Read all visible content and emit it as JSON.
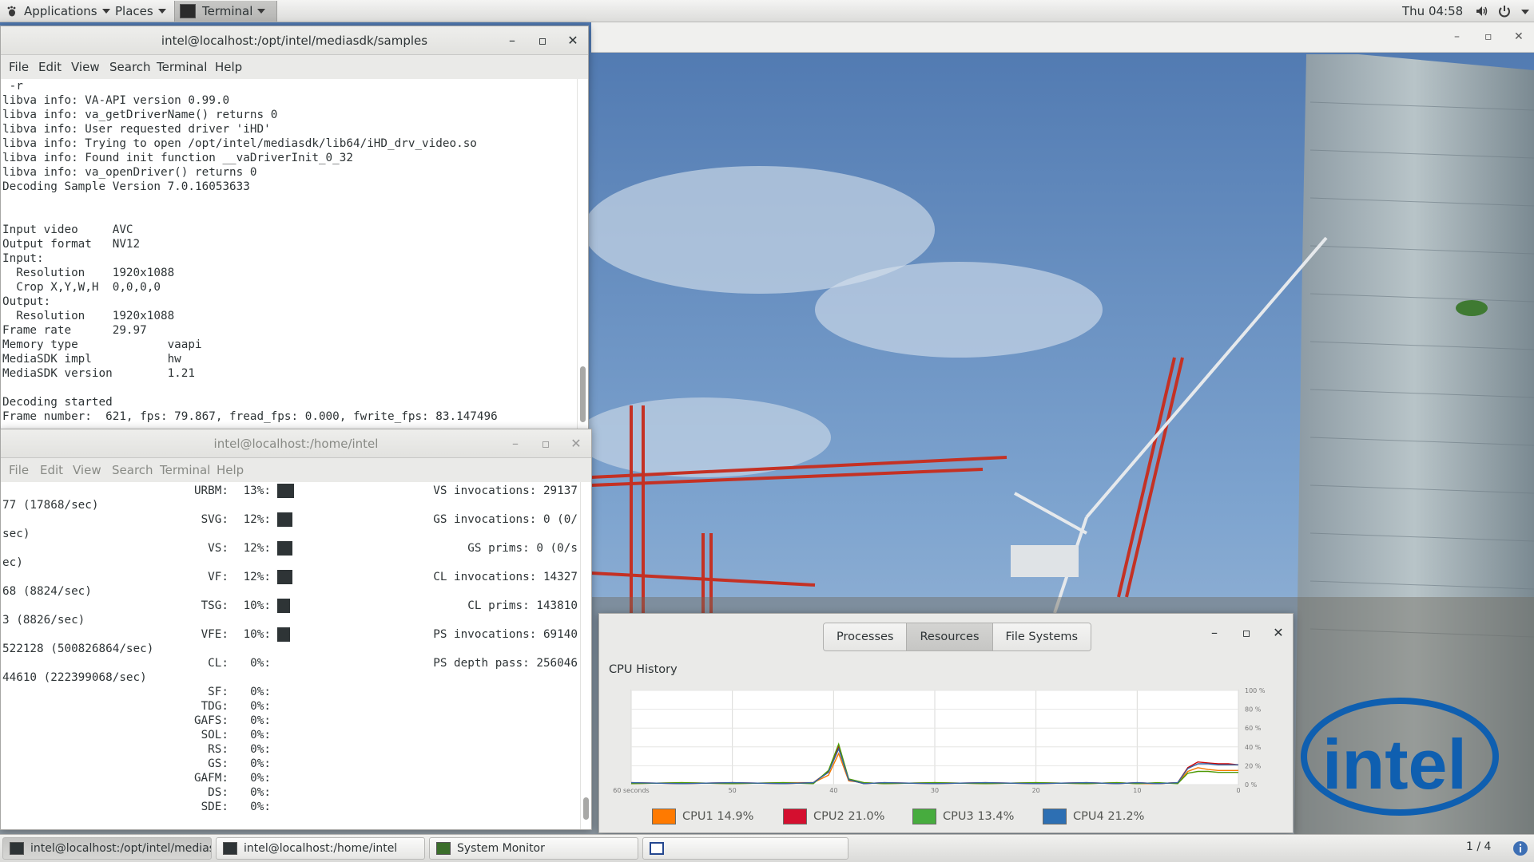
{
  "panel": {
    "applications": "Applications",
    "places": "Places",
    "terminal": "Terminal",
    "clock": "Thu 04:58"
  },
  "term1": {
    "title": "intel@localhost:/opt/intel/mediasdk/samples",
    "menu": [
      "File",
      "Edit",
      "View",
      "Search",
      "Terminal",
      "Help"
    ],
    "lines": [
      " -r",
      "libva info: VA-API version 0.99.0",
      "libva info: va_getDriverName() returns 0",
      "libva info: User requested driver 'iHD'",
      "libva info: Trying to open /opt/intel/mediasdk/lib64/iHD_drv_video.so",
      "libva info: Found init function __vaDriverInit_0_32",
      "libva info: va_openDriver() returns 0",
      "Decoding Sample Version 7.0.16053633",
      "",
      "",
      "Input video     AVC",
      "Output format   NV12",
      "Input:",
      "  Resolution    1920x1088",
      "  Crop X,Y,W,H  0,0,0,0",
      "Output:",
      "  Resolution    1920x1088",
      "Frame rate      29.97",
      "Memory type             vaapi",
      "MediaSDK impl           hw",
      "MediaSDK version        1.21",
      "",
      "Decoding started",
      "Frame number:  621, fps: 79.867, fread_fps: 0.000, fwrite_fps: 83.147496"
    ]
  },
  "term2": {
    "title": "intel@localhost:/home/intel",
    "menu": [
      "File",
      "Edit",
      "View",
      "Search",
      "Terminal",
      "Help"
    ],
    "rows": [
      {
        "left": "",
        "name": "URBM:",
        "pct": "13%:",
        "bar": 13,
        "right": "VS invocations: 29137"
      },
      {
        "left": "77 (17868/sec)",
        "name": "",
        "pct": "",
        "bar": 0,
        "right": ""
      },
      {
        "left": "",
        "name": "SVG:",
        "pct": "12%:",
        "bar": 12,
        "right": "GS invocations: 0 (0/"
      },
      {
        "left": "sec)",
        "name": "",
        "pct": "",
        "bar": 0,
        "right": ""
      },
      {
        "left": "",
        "name": "VS:",
        "pct": "12%:",
        "bar": 12,
        "right": "GS prims: 0 (0/s"
      },
      {
        "left": "ec)",
        "name": "",
        "pct": "",
        "bar": 0,
        "right": ""
      },
      {
        "left": "",
        "name": "VF:",
        "pct": "12%:",
        "bar": 12,
        "right": "CL invocations: 14327"
      },
      {
        "left": "68 (8824/sec)",
        "name": "",
        "pct": "",
        "bar": 0,
        "right": ""
      },
      {
        "left": "",
        "name": "TSG:",
        "pct": "10%:",
        "bar": 10,
        "right": "CL prims: 143810"
      },
      {
        "left": "3 (8826/sec)",
        "name": "",
        "pct": "",
        "bar": 0,
        "right": ""
      },
      {
        "left": "",
        "name": "VFE:",
        "pct": "10%:",
        "bar": 10,
        "right": "PS invocations: 69140"
      },
      {
        "left": "522128 (500826864/sec)",
        "name": "",
        "pct": "",
        "bar": 0,
        "right": ""
      },
      {
        "left": "",
        "name": "CL:",
        "pct": "0%:",
        "bar": 0,
        "right": "PS depth pass: 256046"
      },
      {
        "left": "44610 (222399068/sec)",
        "name": "",
        "pct": "",
        "bar": 0,
        "right": ""
      },
      {
        "left": "",
        "name": "SF:",
        "pct": "0%:",
        "bar": 0,
        "right": ""
      },
      {
        "left": "",
        "name": "TDG:",
        "pct": "0%:",
        "bar": 0,
        "right": ""
      },
      {
        "left": "",
        "name": "GAFS:",
        "pct": "0%:",
        "bar": 0,
        "right": ""
      },
      {
        "left": "",
        "name": "SOL:",
        "pct": "0%:",
        "bar": 0,
        "right": ""
      },
      {
        "left": "",
        "name": "RS:",
        "pct": "0%:",
        "bar": 0,
        "right": ""
      },
      {
        "left": "",
        "name": "GS:",
        "pct": "0%:",
        "bar": 0,
        "right": ""
      },
      {
        "left": "",
        "name": "GAFM:",
        "pct": "0%:",
        "bar": 0,
        "right": ""
      },
      {
        "left": "",
        "name": "DS:",
        "pct": "0%:",
        "bar": 0,
        "right": ""
      },
      {
        "left": "",
        "name": "SDE:",
        "pct": "0%:",
        "bar": 0,
        "right": ""
      }
    ]
  },
  "sysmon": {
    "tabs": [
      "Processes",
      "Resources",
      "File Systems"
    ],
    "active_tab": 1,
    "heading": "CPU History",
    "chart_data": {
      "type": "line",
      "title": "CPU History",
      "x_ticks": [
        "60 seconds",
        "50",
        "40",
        "30",
        "20",
        "10",
        "0"
      ],
      "y_ticks": [
        "100 %",
        "80 %",
        "60 %",
        "40 %",
        "20 %",
        "0 %"
      ],
      "x": [
        60,
        55,
        50,
        45,
        42,
        40.5,
        39.5,
        38.5,
        37,
        35,
        30,
        25,
        20,
        15,
        12,
        10,
        8,
        6,
        5,
        4,
        3,
        2,
        1,
        0
      ],
      "ylim": [
        0,
        100
      ],
      "series": [
        {
          "name": "CPU1",
          "color": "#f57900",
          "values": [
            1,
            2,
            1,
            2,
            2,
            10,
            33,
            4,
            2,
            1,
            2,
            1,
            2,
            1,
            2,
            1,
            1,
            2,
            14,
            18,
            16,
            15,
            15,
            15
          ]
        },
        {
          "name": "CPU2",
          "color": "#cc0000",
          "values": [
            2,
            1,
            2,
            1,
            2,
            14,
            40,
            5,
            1,
            2,
            1,
            2,
            1,
            2,
            1,
            2,
            1,
            2,
            18,
            24,
            23,
            22,
            22,
            21
          ]
        },
        {
          "name": "CPU3",
          "color": "#4e9a06",
          "values": [
            1,
            2,
            1,
            2,
            1,
            15,
            43,
            6,
            2,
            1,
            2,
            1,
            2,
            1,
            2,
            1,
            2,
            1,
            12,
            14,
            14,
            13,
            13,
            13
          ]
        },
        {
          "name": "CPU4",
          "color": "#3465a4",
          "values": [
            2,
            1,
            2,
            1,
            2,
            13,
            38,
            5,
            1,
            2,
            1,
            2,
            1,
            2,
            1,
            2,
            1,
            2,
            17,
            22,
            22,
            21,
            21,
            21
          ]
        }
      ]
    },
    "legend": [
      {
        "label": "CPU1 14.9%",
        "color": "#ff7a00"
      },
      {
        "label": "CPU2 21.0%",
        "color": "#d40f2f"
      },
      {
        "label": "CPU3 13.4%",
        "color": "#47ac3e"
      },
      {
        "label": "CPU4 21.2%",
        "color": "#2d6fb3"
      }
    ]
  },
  "taskbar": {
    "items": [
      "intel@localhost:/opt/intel/medias...",
      "intel@localhost:/home/intel",
      "System Monitor"
    ],
    "workspace": "1 / 4"
  }
}
